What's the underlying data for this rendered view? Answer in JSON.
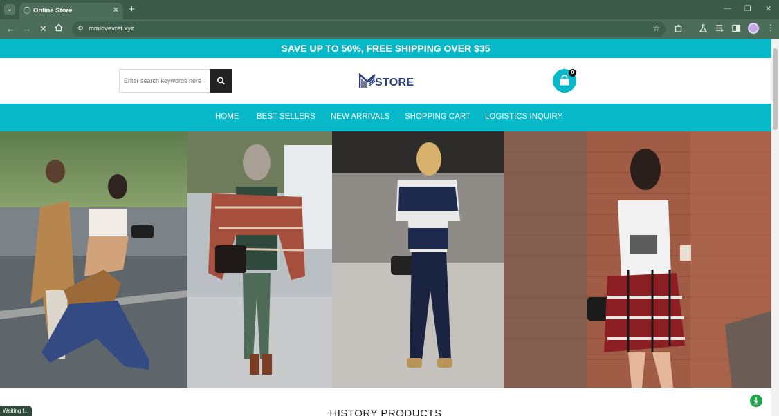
{
  "browser": {
    "tab_title": "Online Store",
    "url": "mmlovevret.xyz",
    "status_text": "Waiting f..."
  },
  "colors": {
    "accent": "#07b9c8",
    "browser_frame": "#3c5a48",
    "logo_blue": "#2a3d7f"
  },
  "promo": {
    "text": "SAVE UP TO 50%, FREE SHIPPING OVER $35"
  },
  "header": {
    "search_placeholder": "Enter search keywords here",
    "logo_text": "STORE",
    "cart_count": "0"
  },
  "nav": {
    "items": [
      "HOME",
      "BEST SELLERS",
      "NEW ARRIVALS",
      "SHOPPING CART",
      "LOGISTICS INQUIRY"
    ]
  },
  "sections": {
    "history_title": "HISTORY PRODUCTS"
  },
  "icons": [
    "tab-search-icon",
    "loading-spinner-icon",
    "close-icon",
    "plus-icon",
    "minimize-icon",
    "restore-icon",
    "back-arrow-icon",
    "forward-arrow-icon",
    "stop-icon",
    "home-icon",
    "site-settings-icon",
    "star-icon",
    "extensions-icon",
    "labs-icon",
    "reading-list-icon",
    "side-panel-icon",
    "avatar",
    "more-menu-icon",
    "search-icon",
    "shopping-bag-icon",
    "chat-icon"
  ]
}
